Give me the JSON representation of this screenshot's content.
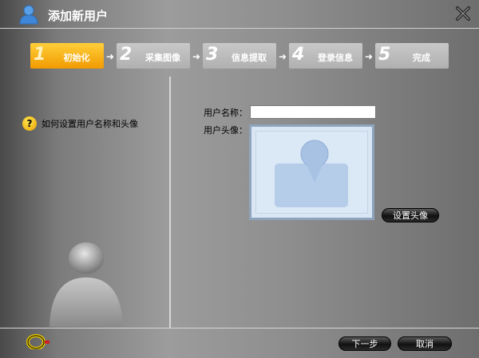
{
  "window": {
    "title": "添加新用户",
    "icons": {
      "title": "user-icon",
      "close": "close-icon"
    }
  },
  "steps": [
    {
      "num": "1",
      "label": "初始化",
      "active": true
    },
    {
      "num": "2",
      "label": "采集图像",
      "active": false
    },
    {
      "num": "3",
      "label": "信息提取",
      "active": false
    },
    {
      "num": "4",
      "label": "登录信息",
      "active": false
    },
    {
      "num": "5",
      "label": "完成",
      "active": false
    }
  ],
  "help": {
    "text": "如何设置用户名称和头像",
    "icon": "question-icon"
  },
  "form": {
    "name_label": "用户名称：",
    "name_value": "",
    "avatar_label": "用户头像：",
    "set_avatar_button": "设置头像"
  },
  "footer": {
    "next_button": "下一步",
    "cancel_button": "取消"
  },
  "colors": {
    "active_step": "#f7b21a",
    "inactive_step": "#bcbcbc",
    "avatar_frame": "#8ea4bd"
  }
}
